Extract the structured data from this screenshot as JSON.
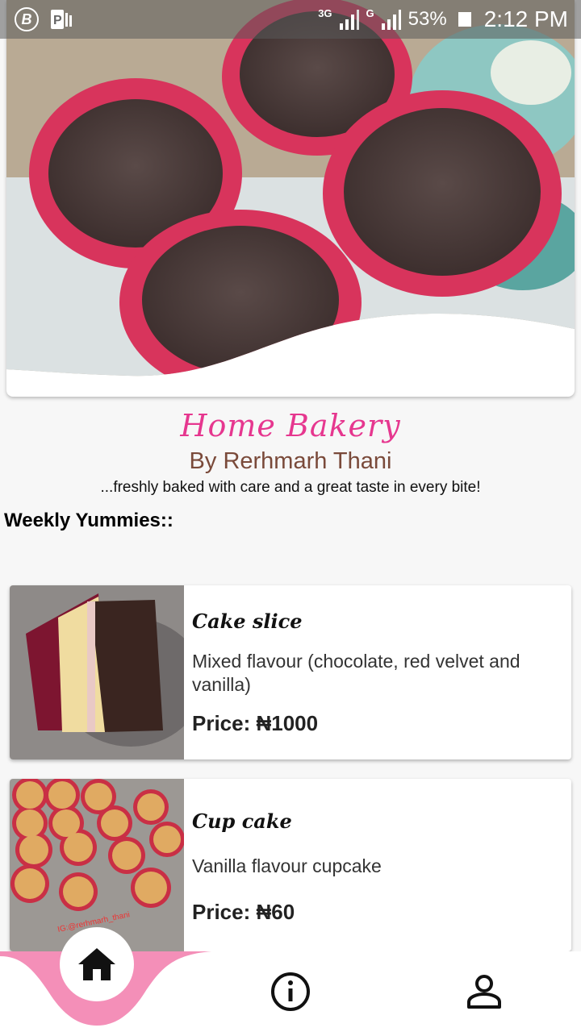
{
  "status_bar": {
    "network_1": "3G",
    "network_2": "G",
    "battery": "53%",
    "time": "2:12 PM"
  },
  "header": {
    "brand": "Home Bakery",
    "owner": "By Rerhmarh Thani",
    "tagline": "...freshly baked with care and a great taste in every bite!"
  },
  "section": {
    "title": "Weekly Yummies::"
  },
  "products": [
    {
      "name": "Cake slice",
      "description": "Mixed flavour (chocolate, red velvet and vanilla)",
      "price": "Price: ₦1000"
    },
    {
      "name": "Cup cake",
      "description": "Vanilla flavour cupcake",
      "price": "Price: ₦60",
      "photo_watermark": "IG:@rerhmarh_thani"
    }
  ],
  "nav": {
    "items": [
      "home-icon",
      "info-icon",
      "profile-icon"
    ],
    "active": "home-icon"
  },
  "colors": {
    "brand": "#e6378f",
    "owner": "#7a4a3a",
    "nav_accent": "#f48fb8"
  }
}
